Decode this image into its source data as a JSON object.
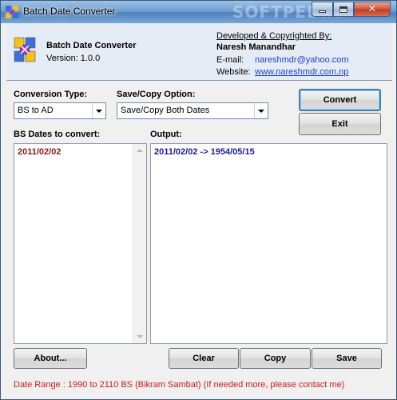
{
  "window": {
    "title": "Batch Date Converter",
    "watermark": "SOFTPEDIA"
  },
  "header": {
    "app_name": "Batch Date Converter",
    "version": "Version: 1.0.0",
    "developed_by": "Developed & Copyrighted By:",
    "developer": "Naresh Manandhar",
    "email_label": "E-mail:",
    "email": "nareshmdr@yahoo.com",
    "website_label": "Website:",
    "website": "www.nareshmdr.com.np"
  },
  "conversion_type": {
    "label": "Conversion Type:",
    "value": "BS to AD"
  },
  "save_copy_option": {
    "label": "Save/Copy Option:",
    "value": "Save/Copy Both Dates"
  },
  "buttons": {
    "convert": "Convert",
    "exit": "Exit",
    "about": "About...",
    "clear": "Clear",
    "copy": "Copy",
    "save": "Save"
  },
  "input": {
    "label": "BS Dates to convert:",
    "content": "2011/02/02"
  },
  "output": {
    "label": "Output:",
    "content": "2011/02/02 -> 1954/05/15"
  },
  "footer": {
    "text": "Date Range : 1990 to 2110 BS (Bikram Sambat)  (If needed more, please contact me)"
  },
  "colors": {
    "input_text": "#8b1a1a",
    "output_text": "#1a1aa0",
    "footer_text": "#cc1b1b",
    "link": "#1c3fd0"
  }
}
